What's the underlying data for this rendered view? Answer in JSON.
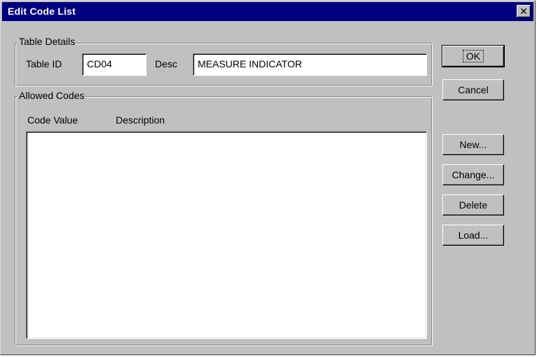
{
  "window": {
    "title": "Edit Code List",
    "close_glyph": "✕"
  },
  "table_details": {
    "group_label": "Table Details",
    "table_id_label": "Table ID",
    "table_id_value": "CD04",
    "desc_label": "Desc",
    "desc_value": "MEASURE INDICATOR"
  },
  "allowed_codes": {
    "group_label": "Allowed Codes",
    "columns": [
      "Code Value",
      "Description"
    ],
    "rows": []
  },
  "buttons": {
    "ok": "OK",
    "cancel": "Cancel",
    "new": "New...",
    "change": "Change...",
    "delete": "Delete",
    "load": "Load..."
  },
  "colors": {
    "titlebar": "#000080",
    "face": "#c0c0c0"
  },
  "icons": {
    "close": "close-icon"
  }
}
